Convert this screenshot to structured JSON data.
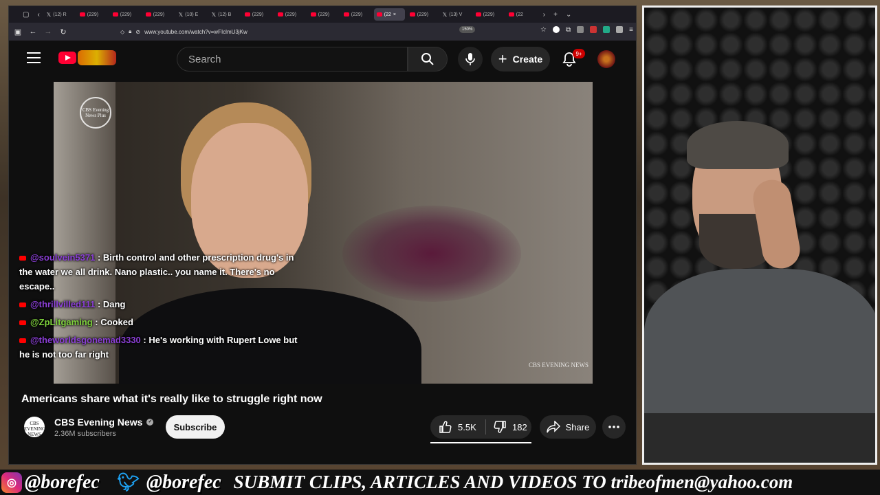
{
  "browser": {
    "tabs": [
      {
        "label": "(12) R",
        "icon": "x-icon"
      },
      {
        "label": "(229)",
        "icon": "youtube-icon"
      },
      {
        "label": "(229)",
        "icon": "youtube-icon"
      },
      {
        "label": "(229)",
        "icon": "youtube-icon"
      },
      {
        "label": "(10) E",
        "icon": "x-icon"
      },
      {
        "label": "(12) B",
        "icon": "x-icon"
      },
      {
        "label": "(229)",
        "icon": "youtube-icon"
      },
      {
        "label": "(229)",
        "icon": "youtube-icon"
      },
      {
        "label": "(229)",
        "icon": "youtube-icon"
      },
      {
        "label": "(229)",
        "icon": "youtube-icon"
      },
      {
        "label": "(22",
        "icon": "youtube-icon",
        "active": true
      },
      {
        "label": "(229)",
        "icon": "youtube-icon"
      },
      {
        "label": "(13) V",
        "icon": "x-icon"
      },
      {
        "label": "(229)",
        "icon": "youtube-icon"
      },
      {
        "label": "(22",
        "icon": "youtube-icon"
      }
    ],
    "url": "www.youtube.com/watch?v=wFIclmU3jKw",
    "zoom": "150%"
  },
  "youtube": {
    "search_placeholder": "Search",
    "create_label": "Create",
    "notifications_badge": "9+",
    "video": {
      "logo_text": "CBS Evening News Plus",
      "bug_text": "CBS EVENING NEWS"
    },
    "chat": [
      {
        "user": "@soulvein5371",
        "text": " : Birth control and other prescription drug's in the water we all drink. Nano plastic.. you name it. There's no escape..",
        "color": "#8b3fd6"
      },
      {
        "user": "@thrillvilled111",
        "text": " : Dang",
        "color": "#8b3fd6"
      },
      {
        "user": "@ZpLitgaming",
        "text": " : Cooked",
        "color": "#7fd33c"
      },
      {
        "user": "@theworldsgonemad3330",
        "text": " : He's working with Rupert Lowe but he is not too far right",
        "color": "#8b3fd6"
      }
    ],
    "title": "Americans share what it's really like to struggle right now",
    "channel": {
      "logo_text": "CBS EVENING NEWS",
      "name": "CBS Evening News",
      "subscribers": "2.36M subscribers"
    },
    "subscribe_label": "Subscribe",
    "likes": "5.5K",
    "dislikes": "182",
    "share_label": "Share"
  },
  "banner": {
    "instagram": "@borefec",
    "twitter": "@borefec",
    "submit_text": "SUBMIT CLIPS, ARTICLES AND VIDEOS TO tribeofmen@yahoo.com"
  }
}
